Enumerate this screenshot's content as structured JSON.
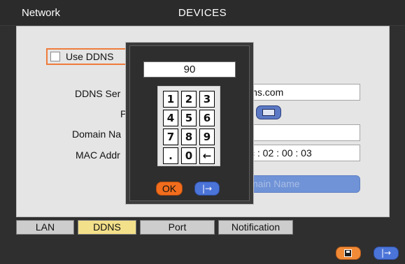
{
  "titlebar": {
    "left": "Network",
    "center": "DEVICES"
  },
  "ddns_toggle": {
    "label": "Use DDNS",
    "checked": false
  },
  "fields": {
    "ddns_server": {
      "label": "DDNS Ser",
      "value": "lns.com"
    },
    "password": {
      "label": "P",
      "icon": "keyboard-icon"
    },
    "domain_name": {
      "label": "Domain Na",
      "value": ""
    },
    "mac_address": {
      "label": "MAC Addr",
      "value": "c : 02 : 00 : 03"
    }
  },
  "domain_button": {
    "label": "main Name"
  },
  "tabs": [
    {
      "label": "LAN",
      "active": false
    },
    {
      "label": "DDNS",
      "active": true
    },
    {
      "label": "Port",
      "active": false
    },
    {
      "label": "Notification",
      "active": false
    }
  ],
  "bottom_buttons": {
    "save_icon": "save-icon",
    "exit_label": "|→"
  },
  "keypad": {
    "display": "90",
    "keys": [
      "1",
      "2",
      "3",
      "4",
      "5",
      "6",
      "7",
      "8",
      "9",
      ".",
      "0",
      "←"
    ],
    "ok_label": "OK",
    "cancel_label": "|→"
  },
  "colors": {
    "frame": "#2f2f2f",
    "content": "#e5e5e5",
    "accent_orange": "#f26d1d",
    "accent_blue": "#4b74d8",
    "tab_active": "#f3e08a"
  }
}
